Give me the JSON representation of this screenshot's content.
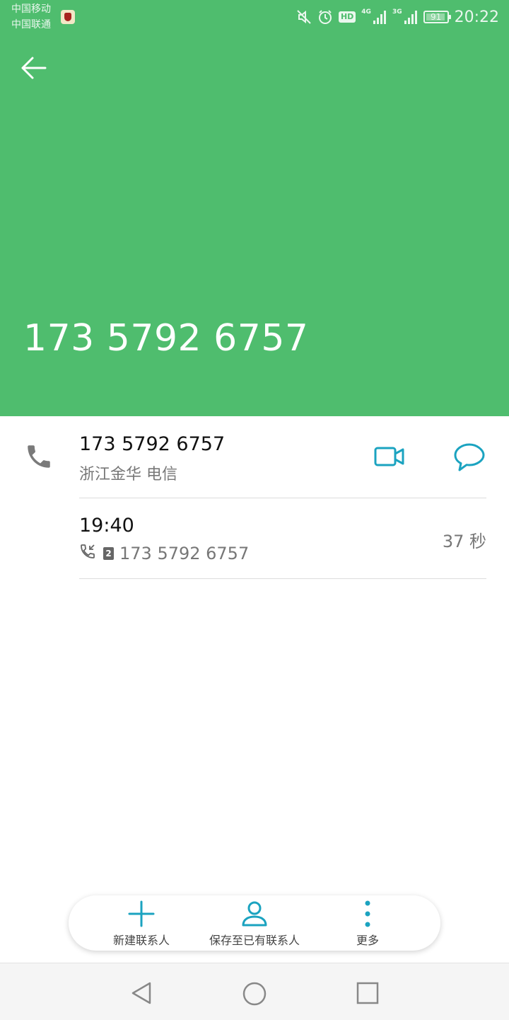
{
  "status_bar": {
    "carrier_1": "中国移动",
    "carrier_2": "中国联通",
    "battery": "91",
    "time": "20:22",
    "hd": "HD",
    "net_1": "4G",
    "net_2": "3G"
  },
  "header": {
    "number": "173 5792 6757",
    "background_color": "#4fbd6e"
  },
  "contact": {
    "number": "173 5792 6757",
    "location": "浙江金华 电信"
  },
  "call_log": {
    "time": "19:40",
    "sim": "2",
    "number": "173 5792 6757",
    "duration": "37 秒"
  },
  "actions": {
    "new_contact": "新建联系人",
    "save_existing": "保存至已有联系人",
    "more": "更多"
  },
  "accent_color": "#1ba3c0",
  "icons": [
    "back-arrow-icon",
    "phone-icon",
    "video-call-icon",
    "message-icon",
    "incoming-call-icon",
    "plus-icon",
    "person-icon",
    "more-vert-icon",
    "nav-back-icon",
    "nav-home-icon",
    "nav-recents-icon"
  ]
}
